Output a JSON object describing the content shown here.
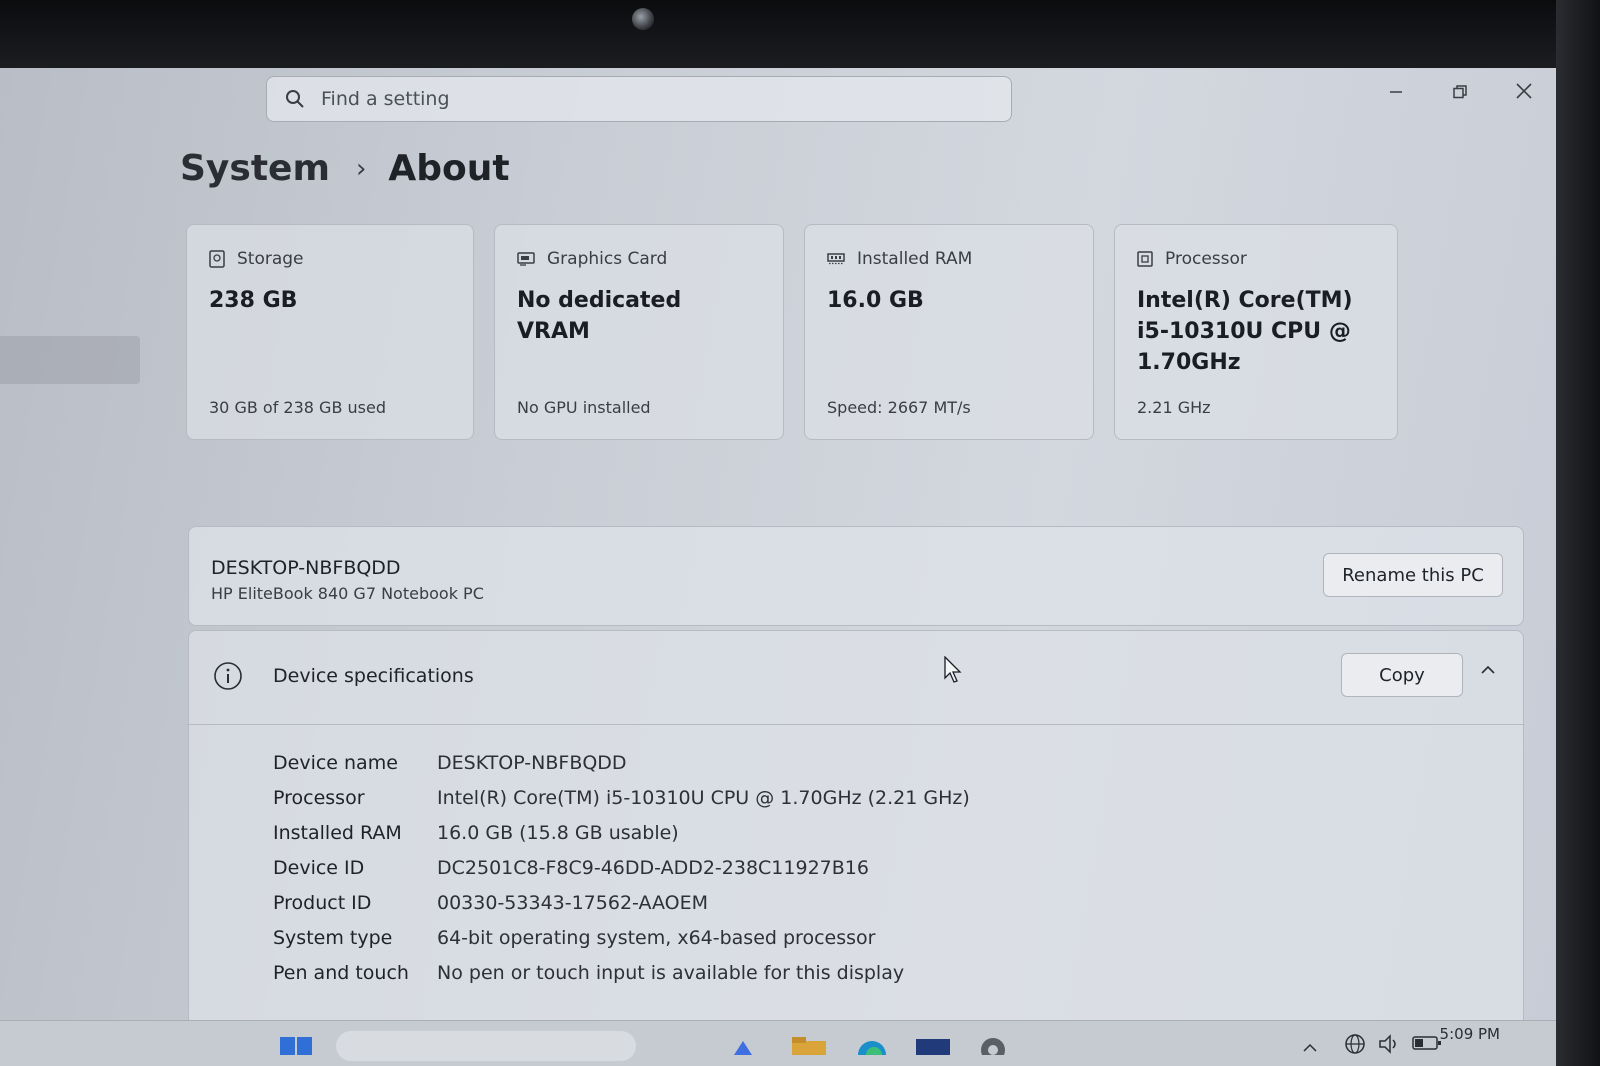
{
  "search": {
    "placeholder": "Find a setting"
  },
  "breadcrumb": {
    "parent": "System",
    "current": "About"
  },
  "cards": {
    "storage": {
      "label": "Storage",
      "value": "238 GB",
      "sub": "30 GB of 238 GB used"
    },
    "graphics": {
      "label": "Graphics Card",
      "value": "No dedicated VRAM",
      "sub": "No GPU installed"
    },
    "ram": {
      "label": "Installed RAM",
      "value": "16.0 GB",
      "sub": "Speed: 2667 MT/s"
    },
    "processor": {
      "label": "Processor",
      "value": "Intel(R) Core(TM) i5-10310U CPU @ 1.70GHz",
      "sub": "2.21 GHz"
    }
  },
  "pc": {
    "name": "DESKTOP-NBFBQDD",
    "model": "HP EliteBook 840 G7 Notebook PC",
    "rename_label": "Rename this PC"
  },
  "specs": {
    "title": "Device specifications",
    "copy_label": "Copy",
    "rows": [
      {
        "key": "Device name",
        "value": "DESKTOP-NBFBQDD"
      },
      {
        "key": "Processor",
        "value": "Intel(R) Core(TM) i5-10310U CPU @ 1.70GHz (2.21 GHz)"
      },
      {
        "key": "Installed RAM",
        "value": "16.0 GB (15.8 GB usable)"
      },
      {
        "key": "Device ID",
        "value": "DC2501C8-F8C9-46DD-ADD2-238C11927B16"
      },
      {
        "key": "Product ID",
        "value": "00330-53343-17562-AAOEM"
      },
      {
        "key": "System type",
        "value": "64-bit operating system, x64-based processor"
      },
      {
        "key": "Pen and touch",
        "value": "No pen or touch input is available for this display"
      }
    ]
  },
  "taskbar": {
    "time": "5:09 PM"
  },
  "icons": {
    "search": "search-icon",
    "minimize": "minimize-icon",
    "restore": "restore-icon",
    "close": "close-icon",
    "storage": "storage-icon",
    "graphics": "graphics-card-icon",
    "ram": "ram-icon",
    "processor": "processor-icon",
    "info": "info-icon",
    "collapse": "chevron-up-icon"
  }
}
